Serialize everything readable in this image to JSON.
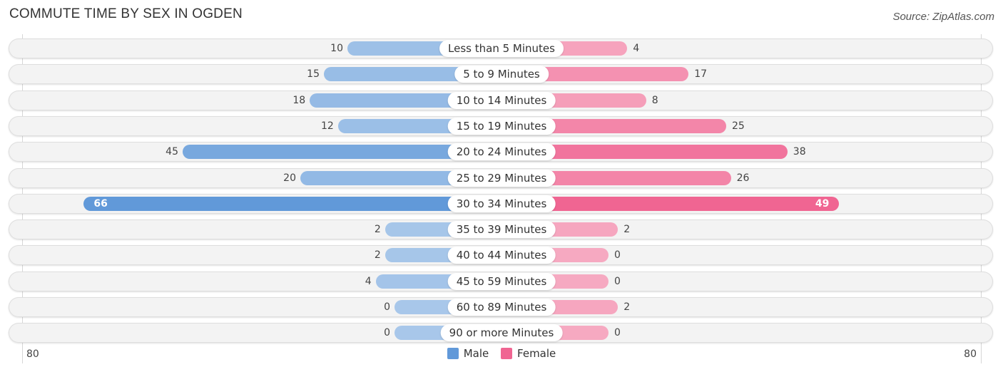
{
  "header": {
    "title": "COMMUTE TIME BY SEX IN OGDEN",
    "source": "Source: ZipAtlas.com"
  },
  "colors": {
    "male_strong": "#6199d9",
    "male_light": "#a8c7ea",
    "female_strong": "#f06592",
    "female_light": "#f6a9c1"
  },
  "chart_data": {
    "type": "bar",
    "orientation": "horizontal-diverging",
    "title": "COMMUTE TIME BY SEX IN OGDEN",
    "categories": [
      "Less than 5 Minutes",
      "5 to 9 Minutes",
      "10 to 14 Minutes",
      "15 to 19 Minutes",
      "20 to 24 Minutes",
      "25 to 29 Minutes",
      "30 to 34 Minutes",
      "35 to 39 Minutes",
      "40 to 44 Minutes",
      "45 to 59 Minutes",
      "60 to 89 Minutes",
      "90 or more Minutes"
    ],
    "series": [
      {
        "name": "Male",
        "values": [
          10,
          15,
          18,
          12,
          45,
          20,
          66,
          2,
          2,
          4,
          0,
          0
        ]
      },
      {
        "name": "Female",
        "values": [
          4,
          17,
          8,
          25,
          38,
          26,
          49,
          2,
          0,
          0,
          2,
          0
        ]
      }
    ],
    "axis": {
      "left_tick": "80",
      "right_tick": "80",
      "range": [
        0,
        80
      ]
    },
    "legend": {
      "position": "bottom-center",
      "items": [
        "Male",
        "Female"
      ]
    }
  }
}
